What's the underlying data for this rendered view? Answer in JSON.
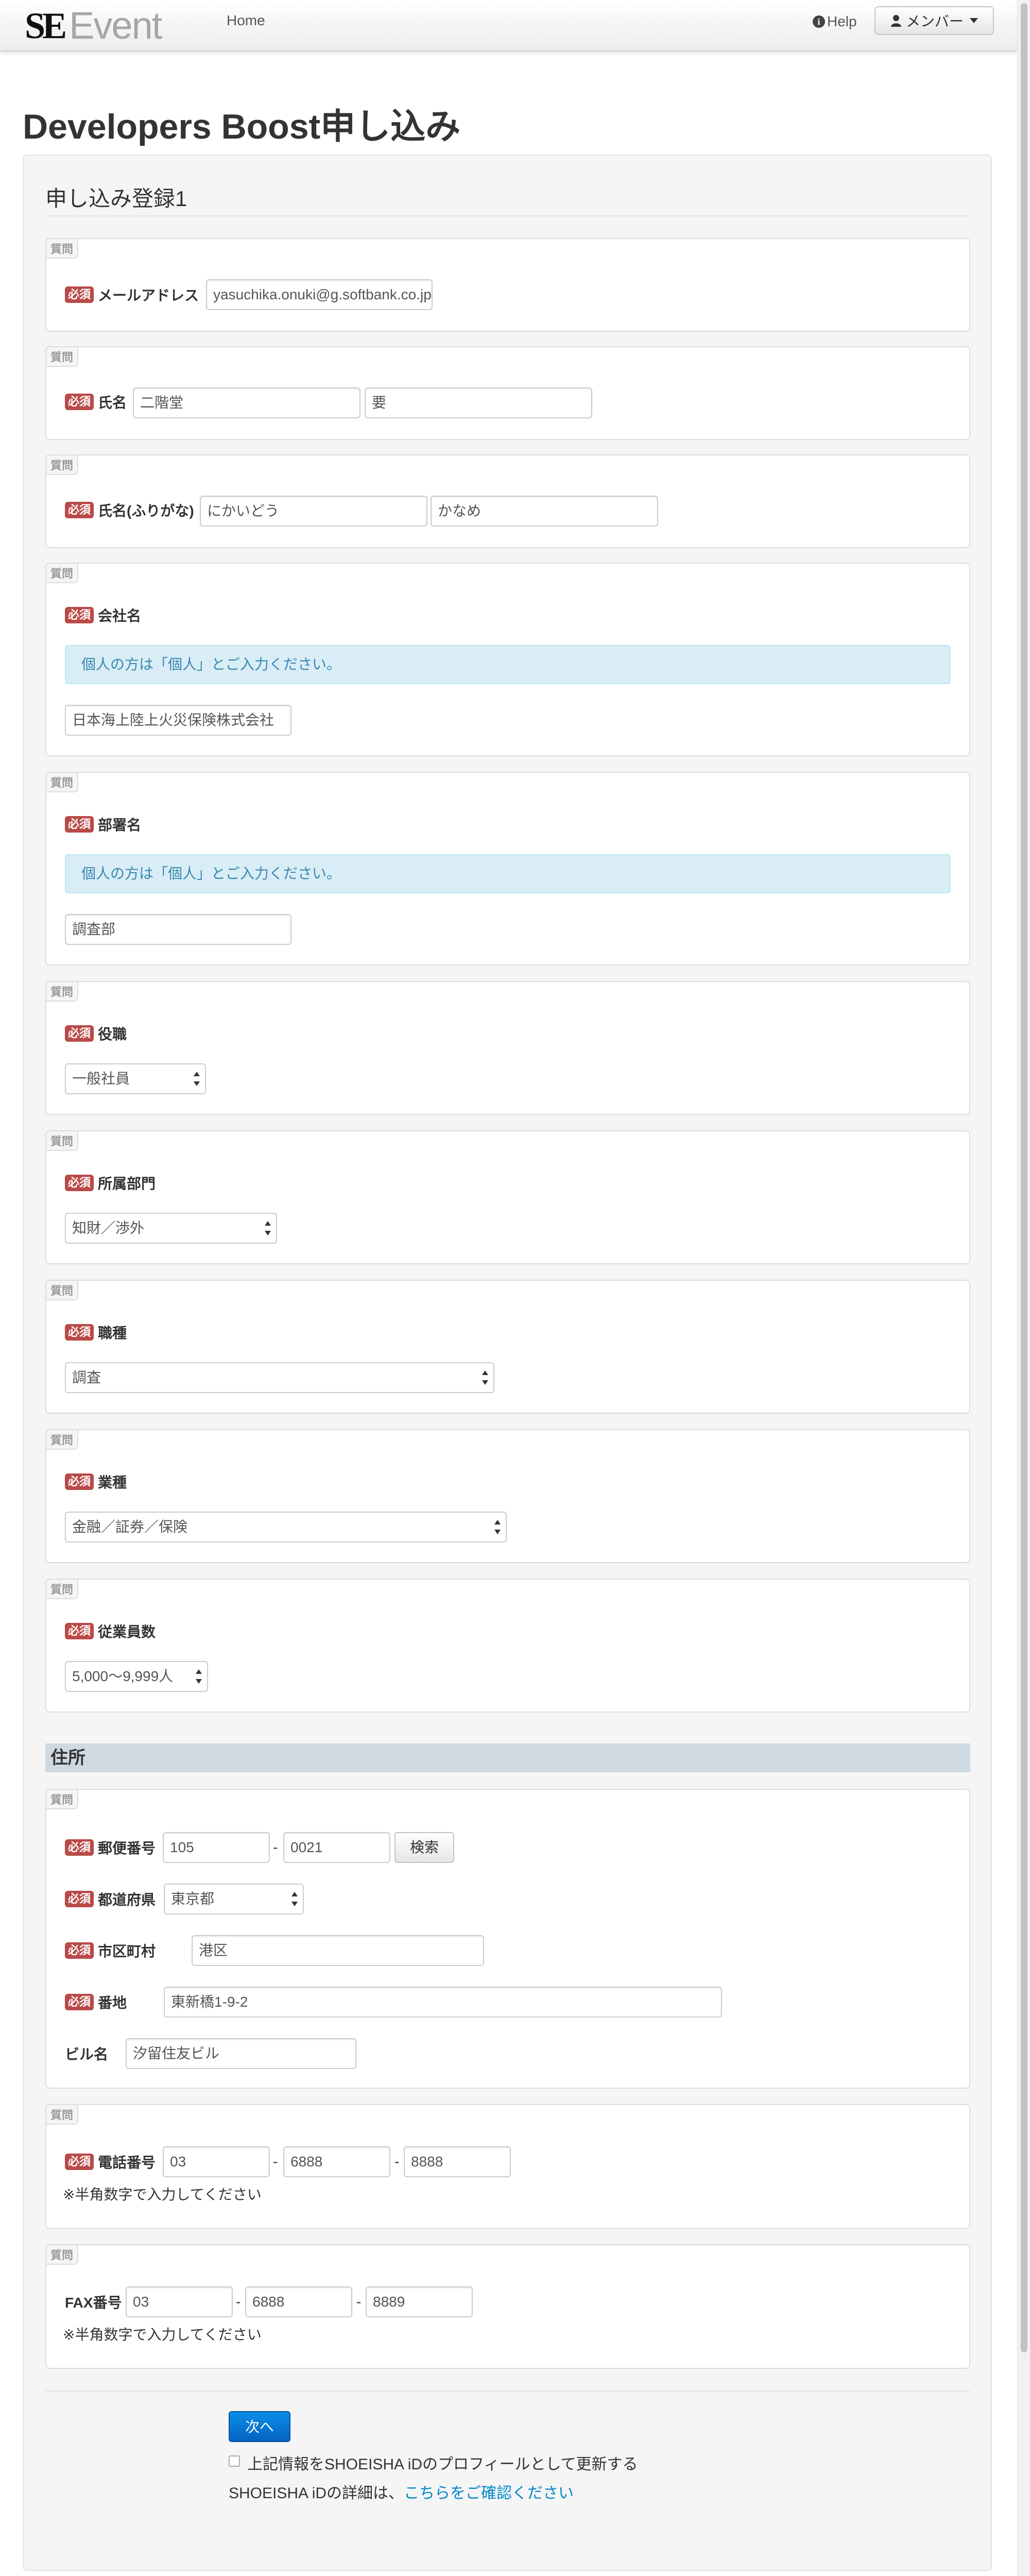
{
  "navbar": {
    "brand_se": "SE",
    "brand_event": "Event",
    "home": "Home",
    "help": "Help",
    "member": "メンバー"
  },
  "page_title": "Developers Boost申し込み",
  "legend": "申し込み登録1",
  "question_tag": "質問",
  "required": "必須",
  "info_individual": "個人の方は「個人」とご入力ください。",
  "fields": {
    "email": {
      "label": "メールアドレス",
      "value": "yasuchika.onuki@g.softbank.co.jp"
    },
    "name": {
      "label": "氏名",
      "last": "二階堂",
      "first": "要"
    },
    "kana": {
      "label": "氏名(ふりがな)",
      "last": "にかいどう",
      "first": "かなめ"
    },
    "company": {
      "label": "会社名",
      "value": "日本海上陸上火災保険株式会社"
    },
    "department": {
      "label": "部署名",
      "value": "調査部"
    },
    "position": {
      "label": "役職",
      "selected": "一般社員"
    },
    "division": {
      "label": "所属部門",
      "selected": "知財／渉外"
    },
    "job": {
      "label": "職種",
      "selected": "調査"
    },
    "industry": {
      "label": "業種",
      "selected": "金融／証券／保険"
    },
    "employees": {
      "label": "従業員数",
      "selected": "5,000〜9,999人"
    }
  },
  "address": {
    "section": "住所",
    "postal_label": "郵便番号",
    "postal1": "105",
    "postal2": "0021",
    "search_button": "検索",
    "pref_label": "都道府県",
    "pref": "東京都",
    "city_label": "市区町村",
    "city": "港区",
    "street_label": "番地",
    "street": "東新橋1-9-2",
    "building_label": "ビル名",
    "building": "汐留住友ビル"
  },
  "phone": {
    "label": "電話番号",
    "p1": "03",
    "p2": "6888",
    "p3": "8888",
    "note": "※半角数字で入力してください"
  },
  "fax": {
    "label": "FAX番号",
    "p1": "03",
    "p2": "6888",
    "p3": "8889",
    "note": "※半角数字で入力してください"
  },
  "dash": "-",
  "footer": {
    "next": "次へ",
    "update_profile": "上記情報をSHOEISHA iDのプロフィールとして更新する",
    "detail_prefix": "SHOEISHA iDの詳細は、",
    "detail_link": "こちらをご確認ください"
  }
}
